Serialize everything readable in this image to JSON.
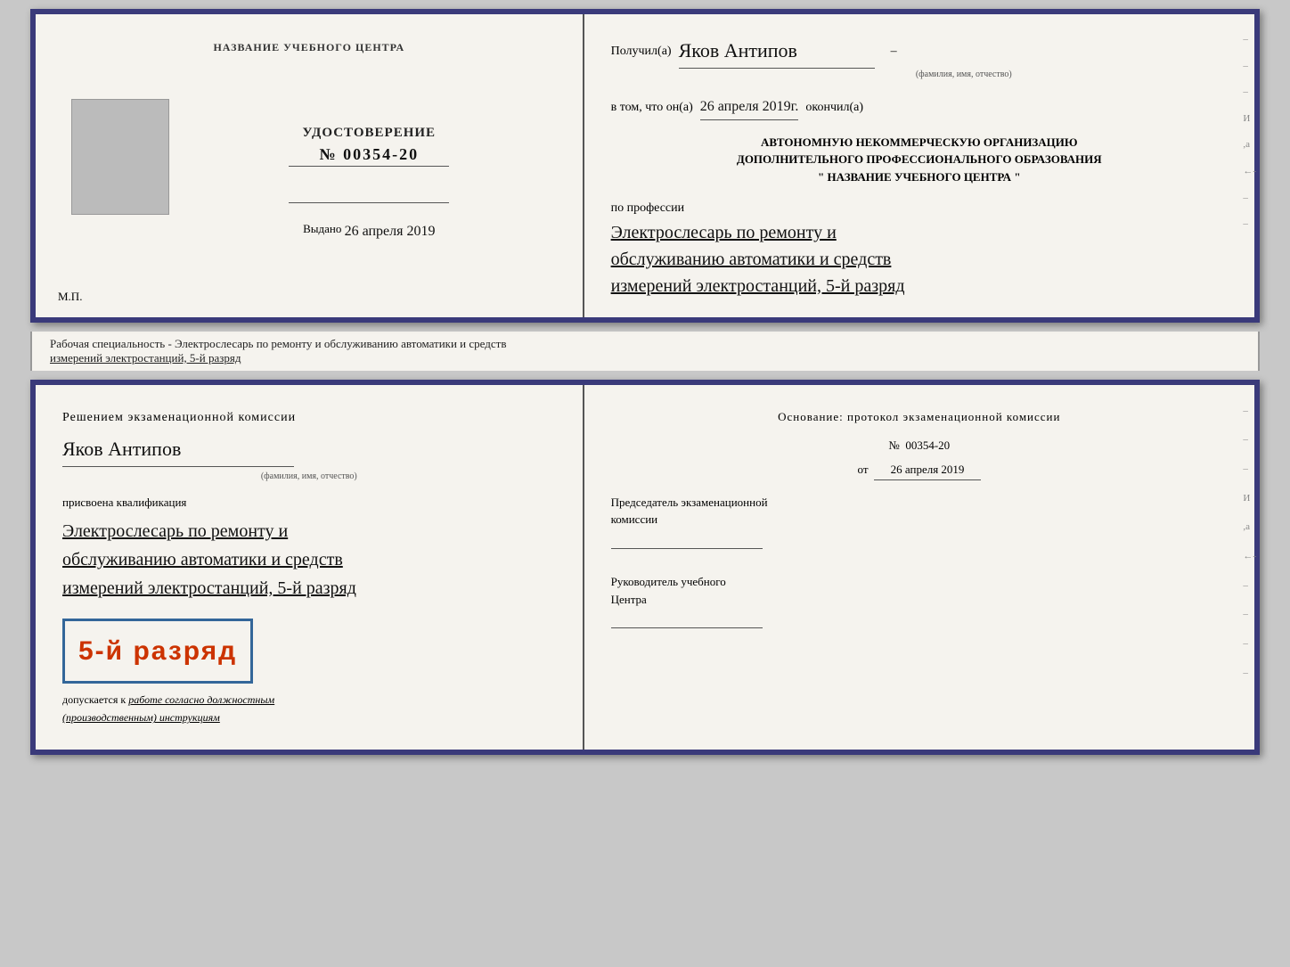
{
  "top_cert": {
    "left": {
      "center_label": "НАЗВАНИЕ УЧЕБНОГО ЦЕНТРА",
      "udostoverenie": "УДОСТОВЕРЕНИЕ",
      "number": "№ 00354-20",
      "vydano_label": "Выдано",
      "vydano_date": "26 апреля 2019",
      "mp": "М.П."
    },
    "right": {
      "poluchil_label": "Получил(а)",
      "recipient_name": "Яков Антипов",
      "fio_caption": "(фамилия, имя, отчество)",
      "vtom_label": "в том, что он(а)",
      "date_value": "26 апреля 2019г.",
      "okonchil_label": "окончил(а)",
      "org_line1": "АВТОНОМНУЮ НЕКОММЕРЧЕСКУЮ ОРГАНИЗАЦИЮ",
      "org_line2": "ДОПОЛНИТЕЛЬНОГО ПРОФЕССИОНАЛЬНОГО ОБРАЗОВАНИЯ",
      "org_quote_open": "\"",
      "org_name": "НАЗВАНИЕ УЧЕБНОГО ЦЕНТРА",
      "org_quote_close": "\"",
      "po_professii": "по профессии",
      "profession_line1": "Электрослесарь по ремонту и",
      "profession_line2": "обслуживанию автоматики и средств",
      "profession_line3": "измерений электростанций, 5-й разряд"
    }
  },
  "label_strip": {
    "text": "Рабочая специальность - Электрослесарь по ремонту и обслуживанию автоматики и средств",
    "text2": "измерений электростанций, 5-й разряд"
  },
  "bottom_cert": {
    "left": {
      "resheniem": "Решением экзаменационной комиссии",
      "name": "Яков Антипов",
      "fio_caption": "(фамилия, имя, отчество)",
      "prisvoena": "присвоена квалификация",
      "qual_line1": "Электрослесарь по ремонту и",
      "qual_line2": "обслуживанию автоматики и средств",
      "qual_line3": "измерений электростанций, 5-й разряд",
      "razryad_text": "5-й разряд",
      "dopuskaetsya": "допускается к",
      "rabote_text": "работе согласно должностным",
      "instruktsii": "(производственным) инструкциям"
    },
    "right": {
      "osnovanie": "Основание: протокол экзаменационной  комиссии",
      "number_label": "№",
      "number_value": "00354-20",
      "ot_label": "от",
      "ot_date": "26 апреля 2019",
      "predsedatel_title": "Председатель экзаменационной",
      "predsedatel_title2": "комиссии",
      "rukovoditel_title": "Руководитель учебного",
      "rukovoditel_title2": "Центра"
    }
  }
}
